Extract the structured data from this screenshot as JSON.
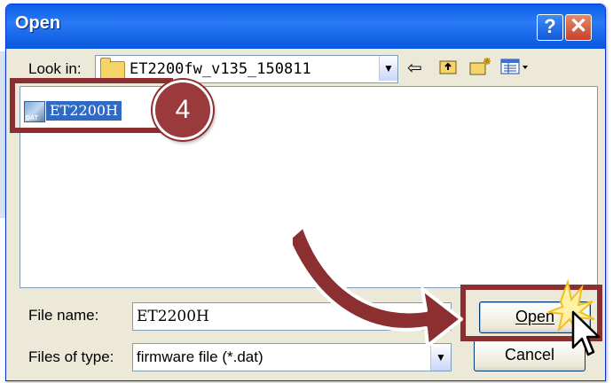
{
  "dialog": {
    "title": "Open",
    "help_button": "?",
    "close_button": "✕"
  },
  "look_in": {
    "label": "Look in:",
    "value": "ET2200fw_v135_150811"
  },
  "toolbar": {
    "back_icon": "⇦",
    "up_folder_icon": "up-folder-icon",
    "new_folder_icon": "new-folder-icon",
    "views_icon": "views-menu-icon"
  },
  "file_list": {
    "items": [
      {
        "name": "ET2200H",
        "icon_label": "DAT",
        "selected": true
      }
    ]
  },
  "callout": {
    "step_number": "4",
    "accent_color": "#8b2f30"
  },
  "form": {
    "file_name_label": "File name:",
    "file_name_value": "ET2200H",
    "files_of_type_label": "Files of type:",
    "files_of_type_value": "firmware file (*.dat)"
  },
  "buttons": {
    "open": "Open",
    "cancel": "Cancel"
  }
}
